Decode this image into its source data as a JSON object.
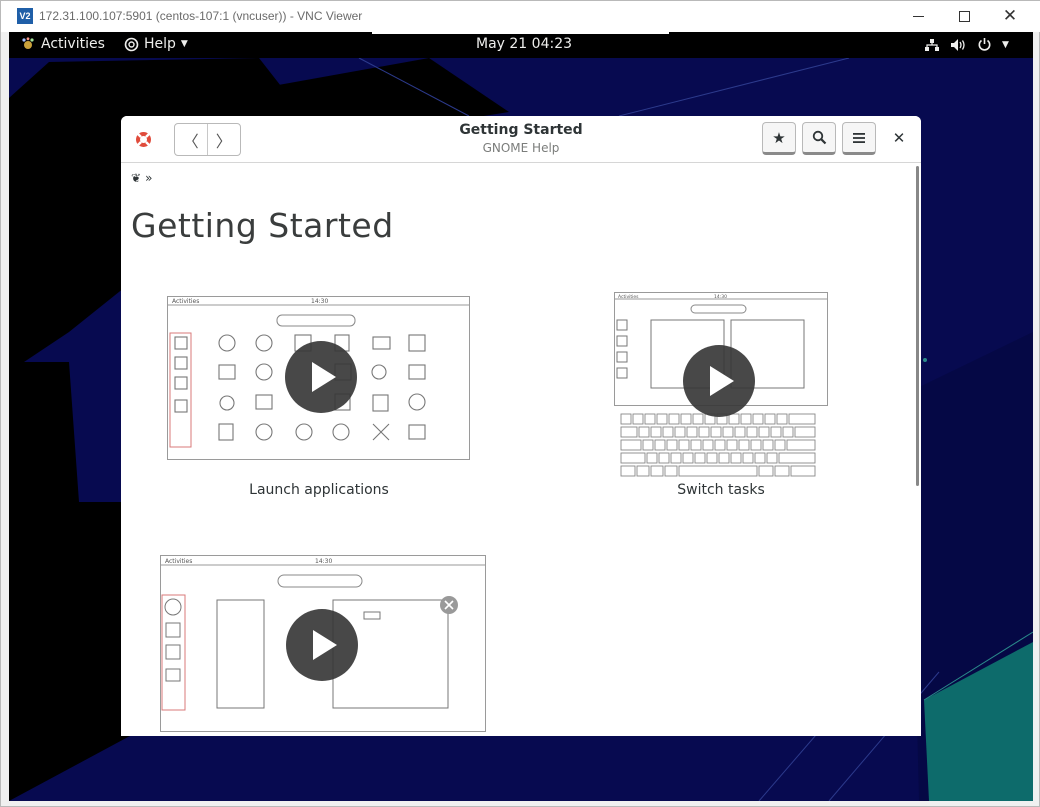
{
  "vnc": {
    "title": "172.31.100.107:5901 (centos-107:1 (vncuser)) - VNC Viewer",
    "logo_text": "V2"
  },
  "topbar": {
    "activities": "Activities",
    "help_menu": "Help",
    "clock": "May 21  04:23"
  },
  "help_window": {
    "title": "Getting Started",
    "subtitle": "GNOME Help",
    "breadcrumb_separator": "»",
    "page_title": "Getting Started"
  },
  "videos": [
    {
      "caption": "Launch applications",
      "thumb_topbar_left": "Activities",
      "thumb_clock": "14:30"
    },
    {
      "caption": "Switch tasks",
      "thumb_topbar_left": "Activities",
      "thumb_clock": "14:30"
    },
    {
      "caption": "",
      "thumb_topbar_left": "Activities",
      "thumb_clock": "14:30"
    }
  ],
  "colors": {
    "desktop_bg": "#070a50",
    "teal_accent": "#0d6b6b",
    "topbar_bg": "#000000"
  }
}
